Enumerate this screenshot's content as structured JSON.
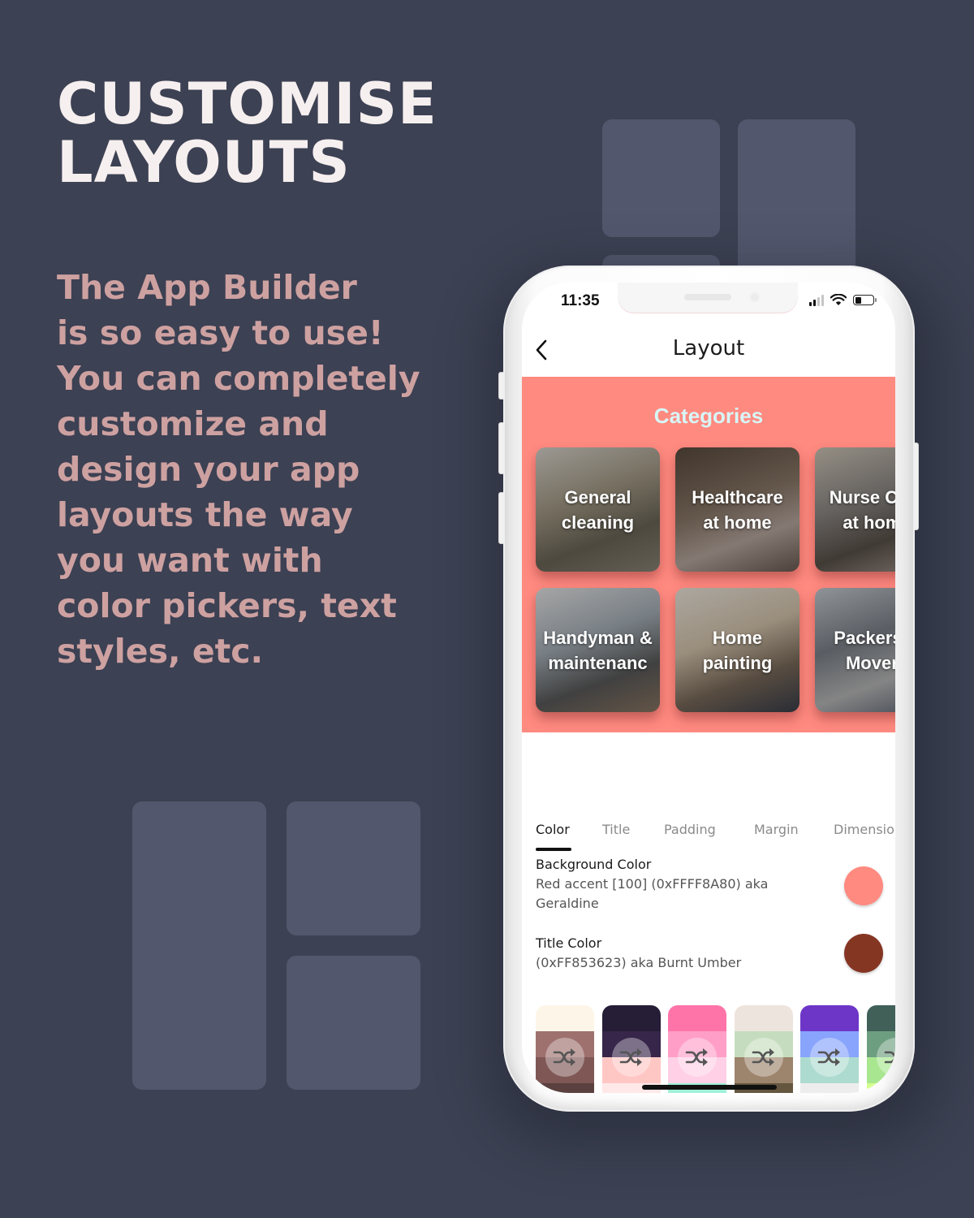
{
  "headline": "CUSTOMISE\nLAYOUTS",
  "body_copy": "The App Builder\nis so easy to use!\nYou can completely\ncustomize and\ndesign your app\nlayouts the way\nyou want with\ncolor pickers, text\nstyles, etc.",
  "phone": {
    "status_bar": {
      "time": "11:35",
      "signal_bars_active": 2,
      "signal_bars_total": 4,
      "wifi_icon": "wifi-icon",
      "battery_level": 0.35
    },
    "app_bar": {
      "back_icon": "chevron-left-icon",
      "title": "Layout"
    },
    "preview": {
      "background_color": "#FF8A80",
      "title": "Categories",
      "title_color": "#D8F6F7",
      "categories": [
        {
          "label": "General\ncleaning",
          "image": "kitchen-cleaning-photo"
        },
        {
          "label": "Healthcare\nat home",
          "image": "healthcare-photo"
        },
        {
          "label": "Nurse Care\nat home",
          "image": "nurse-photo"
        },
        {
          "label": "Handyman &\nmaintenanc",
          "image": "handyman-photo"
        },
        {
          "label": "Home\npainting",
          "image": "painting-photo"
        },
        {
          "label": "Packers &\nMovers",
          "image": "movers-photo"
        }
      ]
    },
    "tabs": [
      {
        "label": "Color",
        "active": true
      },
      {
        "label": "Title",
        "active": false
      },
      {
        "label": "Padding",
        "active": false
      },
      {
        "label": "Margin",
        "active": false
      },
      {
        "label": "Dimensions",
        "active": false
      }
    ],
    "settings": [
      {
        "label": "Background Color",
        "value": "Red accent [100] (0xFFFF8A80) aka Geraldine",
        "color": "#FF8A80"
      },
      {
        "label": "Title Color",
        "value": "(0xFF853623) aka Burnt Umber",
        "color": "#853623"
      }
    ],
    "palettes": [
      {
        "colors": [
          "#FDF6E8",
          "#9E716E",
          "#7F5856",
          "#5A4140"
        ]
      },
      {
        "colors": [
          "#261D37",
          "#37264A",
          "#FFC7C4",
          "#FFE8E8"
        ]
      },
      {
        "colors": [
          "#FF74A8",
          "#FF9FC8",
          "#FFD0E6",
          "#A0F0D8"
        ]
      },
      {
        "colors": [
          "#EEE4DE",
          "#C5DDBE",
          "#9D846C",
          "#65573F"
        ]
      },
      {
        "colors": [
          "#6E36C7",
          "#88A4FC",
          "#AEDBCF",
          "#EDEDED"
        ]
      },
      {
        "colors": [
          "#406058",
          "#6E9E80",
          "#A8E690",
          "#D4FF8C"
        ]
      }
    ],
    "shuffle_icon": "shuffle-icon"
  }
}
